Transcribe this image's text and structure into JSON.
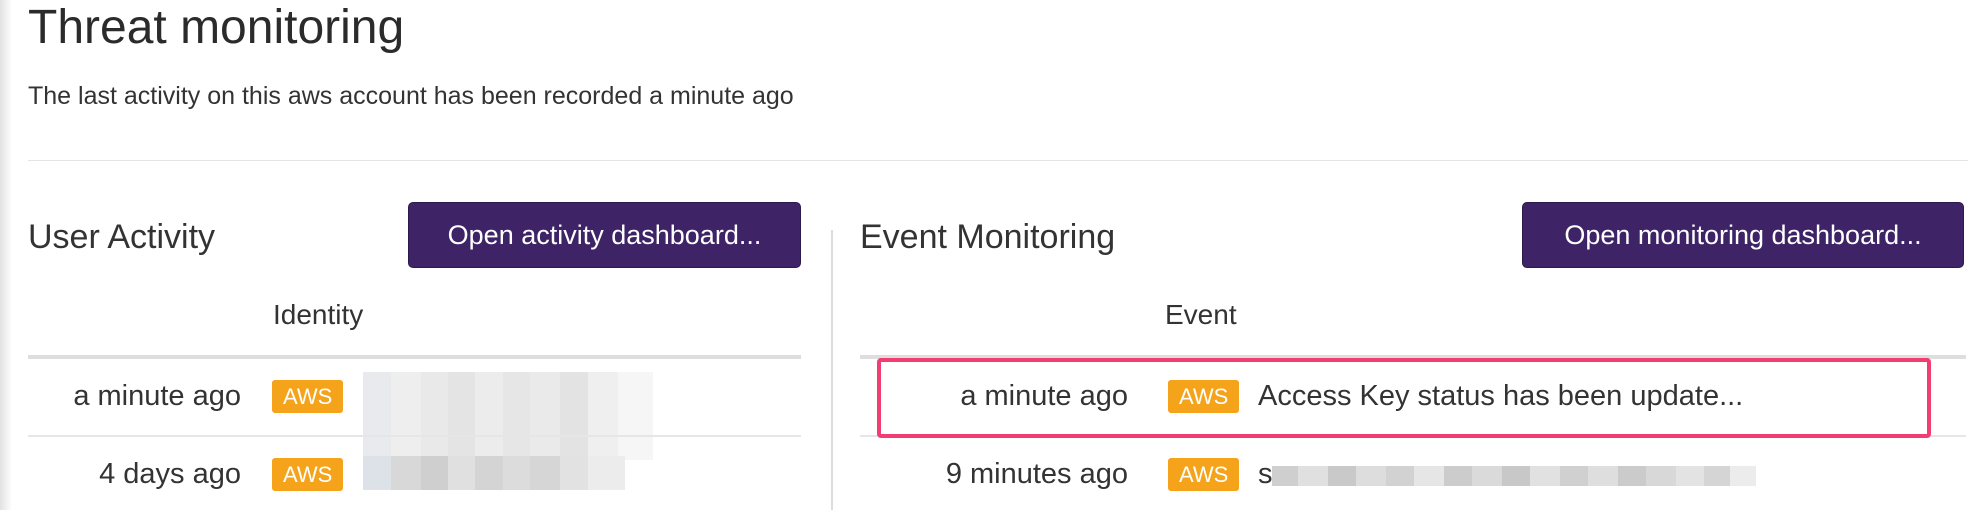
{
  "page": {
    "title": "Threat monitoring",
    "subtitle": "The last activity on this aws account has been recorded a minute ago"
  },
  "user_activity": {
    "title": "User Activity",
    "button_label": "Open activity dashboard...",
    "column_header": "Identity",
    "rows": [
      {
        "time": "a minute ago",
        "badge": "AWS",
        "identity": "redacted"
      },
      {
        "time": "4 days ago",
        "badge": "AWS",
        "identity": "redacted"
      }
    ]
  },
  "event_monitoring": {
    "title": "Event Monitoring",
    "button_label": "Open monitoring dashboard...",
    "column_header": "Event",
    "rows": [
      {
        "time": "a minute ago",
        "badge": "AWS",
        "event": "Access Key status has been update...",
        "highlighted": true
      },
      {
        "time": "9 minutes ago",
        "badge": "AWS",
        "event": "s",
        "event_redacted": true
      }
    ]
  },
  "colors": {
    "button_bg": "#3e2466",
    "badge_bg": "#f5a31a",
    "highlight_border": "#f23d73"
  }
}
